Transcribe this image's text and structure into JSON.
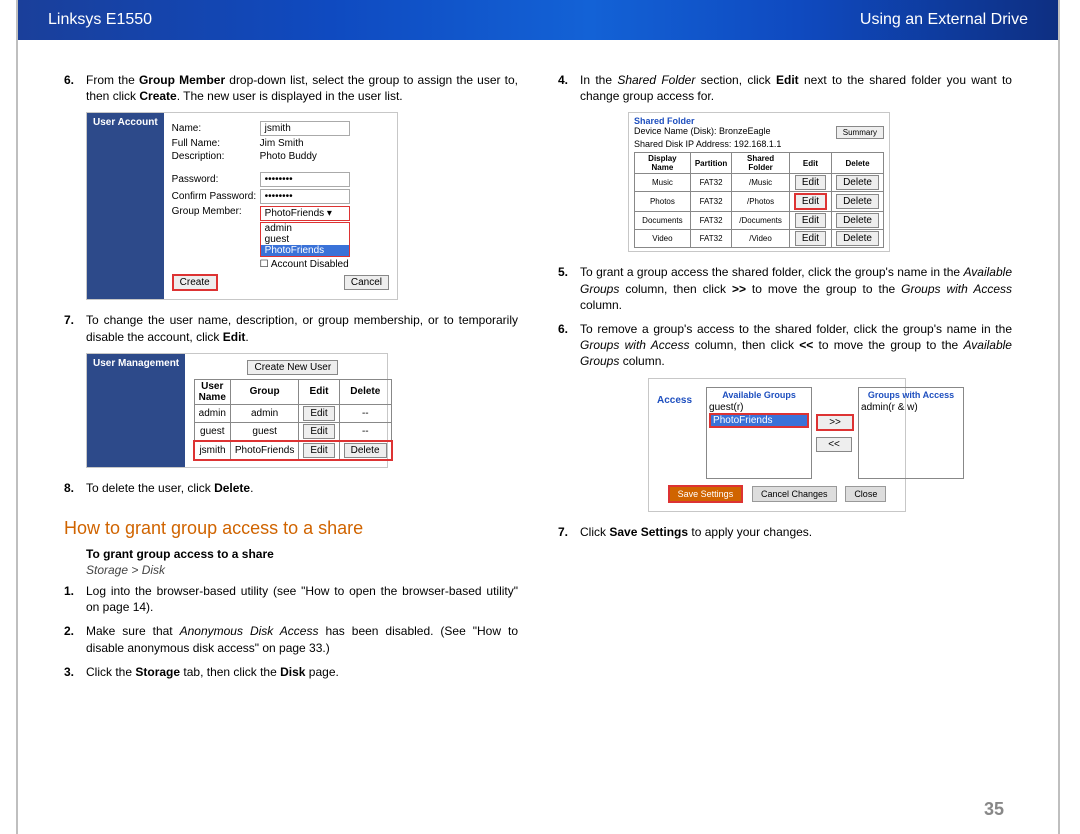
{
  "header": {
    "left": "Linksys E1550",
    "right": "Using an External Drive"
  },
  "left_col": {
    "step6": {
      "n": "6.",
      "text_a": "From the ",
      "b1": "Group Member",
      "text_b": " drop-down list, select the group to assign the user to, then click ",
      "b2": "Create",
      "text_c": ". The new user is displayed in the user list."
    },
    "user_account": {
      "title": "User Account",
      "fields": {
        "name_lbl": "Name:",
        "name_val": "jsmith",
        "full_lbl": "Full Name:",
        "full_val": "Jim Smith",
        "desc_lbl": "Description:",
        "desc_val": "Photo Buddy",
        "pass_lbl": "Password:",
        "pass_val": "••••••••",
        "cpass_lbl": "Confirm Password:",
        "cpass_val": "••••••••",
        "group_lbl": "Group Member:",
        "group_val": "PhotoFriends",
        "opts": [
          "admin",
          "guest",
          "PhotoFriends"
        ],
        "chk": "Account Disabled",
        "create": "Create",
        "cancel": "Cancel"
      }
    },
    "step7": {
      "n": "7.",
      "text_a": "To change the user name, description, or group membership, or to temporarily disable the account, click ",
      "b1": "Edit",
      "text_b": "."
    },
    "user_mgmt": {
      "title": "User Management",
      "create_btn": "Create New User",
      "cols": [
        "User Name",
        "Group",
        "Edit",
        "Delete"
      ],
      "rows": [
        {
          "user": "admin",
          "group": "admin",
          "edit": "Edit",
          "del": "--"
        },
        {
          "user": "guest",
          "group": "guest",
          "edit": "Edit",
          "del": "--"
        },
        {
          "user": "jsmith",
          "group": "PhotoFriends",
          "edit": "Edit",
          "del": "Delete"
        }
      ]
    },
    "step8": {
      "n": "8.",
      "text_a": "To delete the user, click ",
      "b1": "Delete",
      "text_b": "."
    },
    "h2": "How to grant group access to a share",
    "subhead": "To grant group access to a share",
    "path": "Storage > Disk",
    "s1": {
      "n": "1.",
      "a": "Log into the browser-based utility (see \"How to open the browser-based utility\" on page 14)."
    },
    "s2": {
      "n": "2.",
      "a": "Make sure that ",
      "i": "Anonymous Disk Access",
      "b": " has been disabled. (See \"How to disable anonymous disk access\" on page 33.)"
    },
    "s3": {
      "n": "3.",
      "a": "Click the ",
      "b1": "Storage",
      "c": " tab, then click the ",
      "b2": "Disk",
      "d": " page."
    }
  },
  "right_col": {
    "step4": {
      "n": "4.",
      "a": "In the ",
      "i": "Shared Folder",
      "b": " section, click ",
      "b1": "Edit",
      "c": " next to the shared folder you want to change group access for."
    },
    "shared": {
      "title": "Shared Folder",
      "dev": "Device Name (Disk): BronzeEagle",
      "ip": "Shared Disk IP Address: 192.168.1.1",
      "summary": "Summary",
      "cols": [
        "Display Name",
        "Partition",
        "Shared Folder",
        "Edit",
        "Delete"
      ],
      "rows": [
        {
          "dn": "Music",
          "p": "FAT32",
          "sf": "/Music",
          "e": "Edit",
          "d": "Delete"
        },
        {
          "dn": "Photos",
          "p": "FAT32",
          "sf": "/Photos",
          "e": "Edit",
          "d": "Delete"
        },
        {
          "dn": "Documents",
          "p": "FAT32",
          "sf": "/Documents",
          "e": "Edit",
          "d": "Delete"
        },
        {
          "dn": "Video",
          "p": "FAT32",
          "sf": "/Video",
          "e": "Edit",
          "d": "Delete"
        }
      ]
    },
    "step5": {
      "n": "5.",
      "a": "To grant a group access the shared folder, click the group's name in the ",
      "i1": "Available Groups",
      "b": " column, then click ",
      "b1": ">>",
      "c": " to move the group to the ",
      "i2": "Groups with Access",
      "d": " column."
    },
    "step6": {
      "n": "6.",
      "a": "To remove a group's access to the shared folder, click the group's name in the ",
      "i1": "Groups with Access",
      "b": " column, then click ",
      "b1": "<<",
      "c": " to move the group to the ",
      "i2": "Available Groups",
      "d": " column."
    },
    "access": {
      "title": "Access",
      "available": "Available Groups",
      "with": "Groups with Access",
      "av_items": [
        "guest(r)",
        "PhotoFriends"
      ],
      "wa_items": [
        "admin(r & w)"
      ],
      "btn_r": ">>",
      "btn_l": "<<",
      "save": "Save Settings",
      "cancel": "Cancel Changes",
      "close": "Close"
    },
    "step7": {
      "n": "7.",
      "a": "Click ",
      "b1": "Save Settings",
      "b": " to apply your changes."
    }
  },
  "page_num": "35"
}
